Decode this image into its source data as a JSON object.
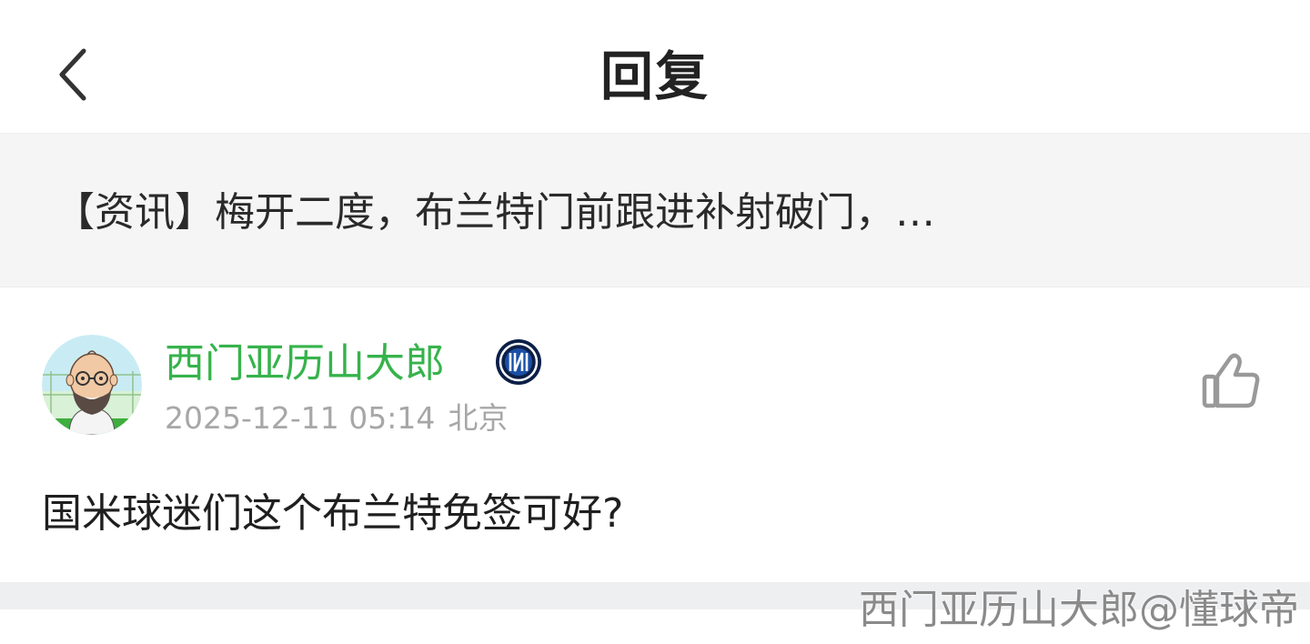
{
  "header": {
    "back_icon": "chevron-left-icon",
    "title": "回复"
  },
  "article": {
    "title": "【资讯】梅开二度，布兰特门前跟进补射破门，…"
  },
  "comment": {
    "username": "西门亚历山大郎",
    "username_color": "#36b34c",
    "badge_icon": "inter-milan-badge-icon",
    "timestamp": "2025-12-11 05:14",
    "location": "北京",
    "text": "国米球迷们这个布兰特免签可好?",
    "like_icon": "thumbs-up-icon"
  },
  "watermark": "西门亚历山大郎@懂球帝"
}
